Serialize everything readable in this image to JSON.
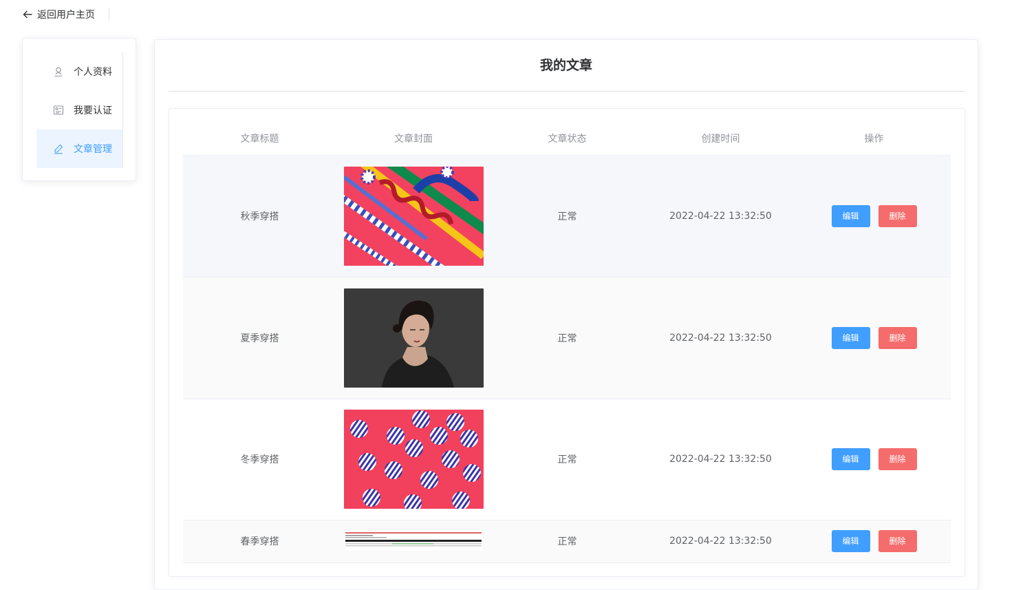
{
  "topbar": {
    "back_label": "返回用户主页"
  },
  "sidebar": {
    "items": [
      {
        "label": "个人资料",
        "icon": "user-icon",
        "active": false
      },
      {
        "label": "我要认证",
        "icon": "id-card-icon",
        "active": false
      },
      {
        "label": "文章管理",
        "icon": "edit-pen-icon",
        "active": true
      }
    ]
  },
  "main": {
    "title": "我的文章",
    "columns": [
      "文章标题",
      "文章封面",
      "文章状态",
      "创建时间",
      "操作"
    ],
    "rows": [
      {
        "title": "秋季穿搭",
        "cover": "abstract-stripes-image",
        "status": "正常",
        "created": "2022-04-22 13:32:50"
      },
      {
        "title": "夏季穿搭",
        "cover": "portrait-woman-image",
        "status": "正常",
        "created": "2022-04-22 13:32:50"
      },
      {
        "title": "冬季穿搭",
        "cover": "striped-balls-image",
        "status": "正常",
        "created": "2022-04-22 13:32:50"
      },
      {
        "title": "春季穿搭",
        "cover": "screenshot-thumbnail-image",
        "status": "正常",
        "created": "2022-04-22 13:32:50"
      }
    ],
    "edit_label": "编辑",
    "delete_label": "删除"
  },
  "colors": {
    "primary": "#409eff",
    "danger": "#f56c6c",
    "active_bg": "#ecf5ff"
  }
}
